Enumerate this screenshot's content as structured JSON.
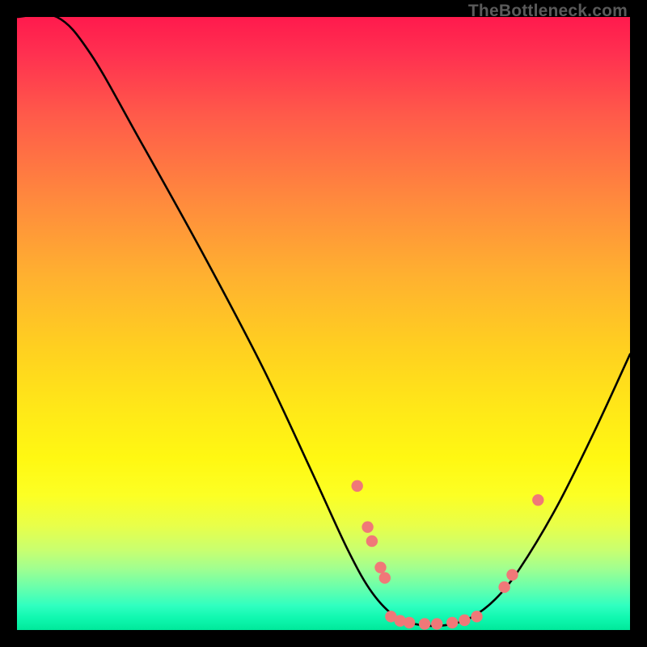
{
  "watermark": "TheBottleneck.com",
  "chart_data": {
    "type": "line",
    "title": "",
    "xlabel": "",
    "ylabel": "",
    "xlim": [
      0,
      100
    ],
    "ylim": [
      0,
      100
    ],
    "curve": [
      {
        "x": 0,
        "y": 100
      },
      {
        "x": 6.5,
        "y": 100
      },
      {
        "x": 12,
        "y": 94
      },
      {
        "x": 20,
        "y": 80
      },
      {
        "x": 30,
        "y": 62
      },
      {
        "x": 40,
        "y": 43
      },
      {
        "x": 48,
        "y": 26
      },
      {
        "x": 54,
        "y": 13
      },
      {
        "x": 58,
        "y": 6
      },
      {
        "x": 62,
        "y": 2
      },
      {
        "x": 66,
        "y": 0.8
      },
      {
        "x": 70,
        "y": 0.8
      },
      {
        "x": 74,
        "y": 2
      },
      {
        "x": 78,
        "y": 5
      },
      {
        "x": 82,
        "y": 10
      },
      {
        "x": 88,
        "y": 20
      },
      {
        "x": 94,
        "y": 32
      },
      {
        "x": 100,
        "y": 45
      }
    ],
    "points": [
      {
        "x": 55.5,
        "y": 23.5
      },
      {
        "x": 57.2,
        "y": 16.8
      },
      {
        "x": 57.9,
        "y": 14.5
      },
      {
        "x": 59.3,
        "y": 10.2
      },
      {
        "x": 60.0,
        "y": 8.5
      },
      {
        "x": 61.0,
        "y": 2.2
      },
      {
        "x": 62.5,
        "y": 1.5
      },
      {
        "x": 64.0,
        "y": 1.2
      },
      {
        "x": 66.5,
        "y": 1.0
      },
      {
        "x": 68.5,
        "y": 1.0
      },
      {
        "x": 71.0,
        "y": 1.2
      },
      {
        "x": 73.0,
        "y": 1.6
      },
      {
        "x": 75.0,
        "y": 2.2
      },
      {
        "x": 79.5,
        "y": 7.0
      },
      {
        "x": 80.8,
        "y": 9.0
      },
      {
        "x": 85.0,
        "y": 21.2
      }
    ],
    "colors": {
      "curve": "#000000",
      "points": "#f07878"
    }
  }
}
